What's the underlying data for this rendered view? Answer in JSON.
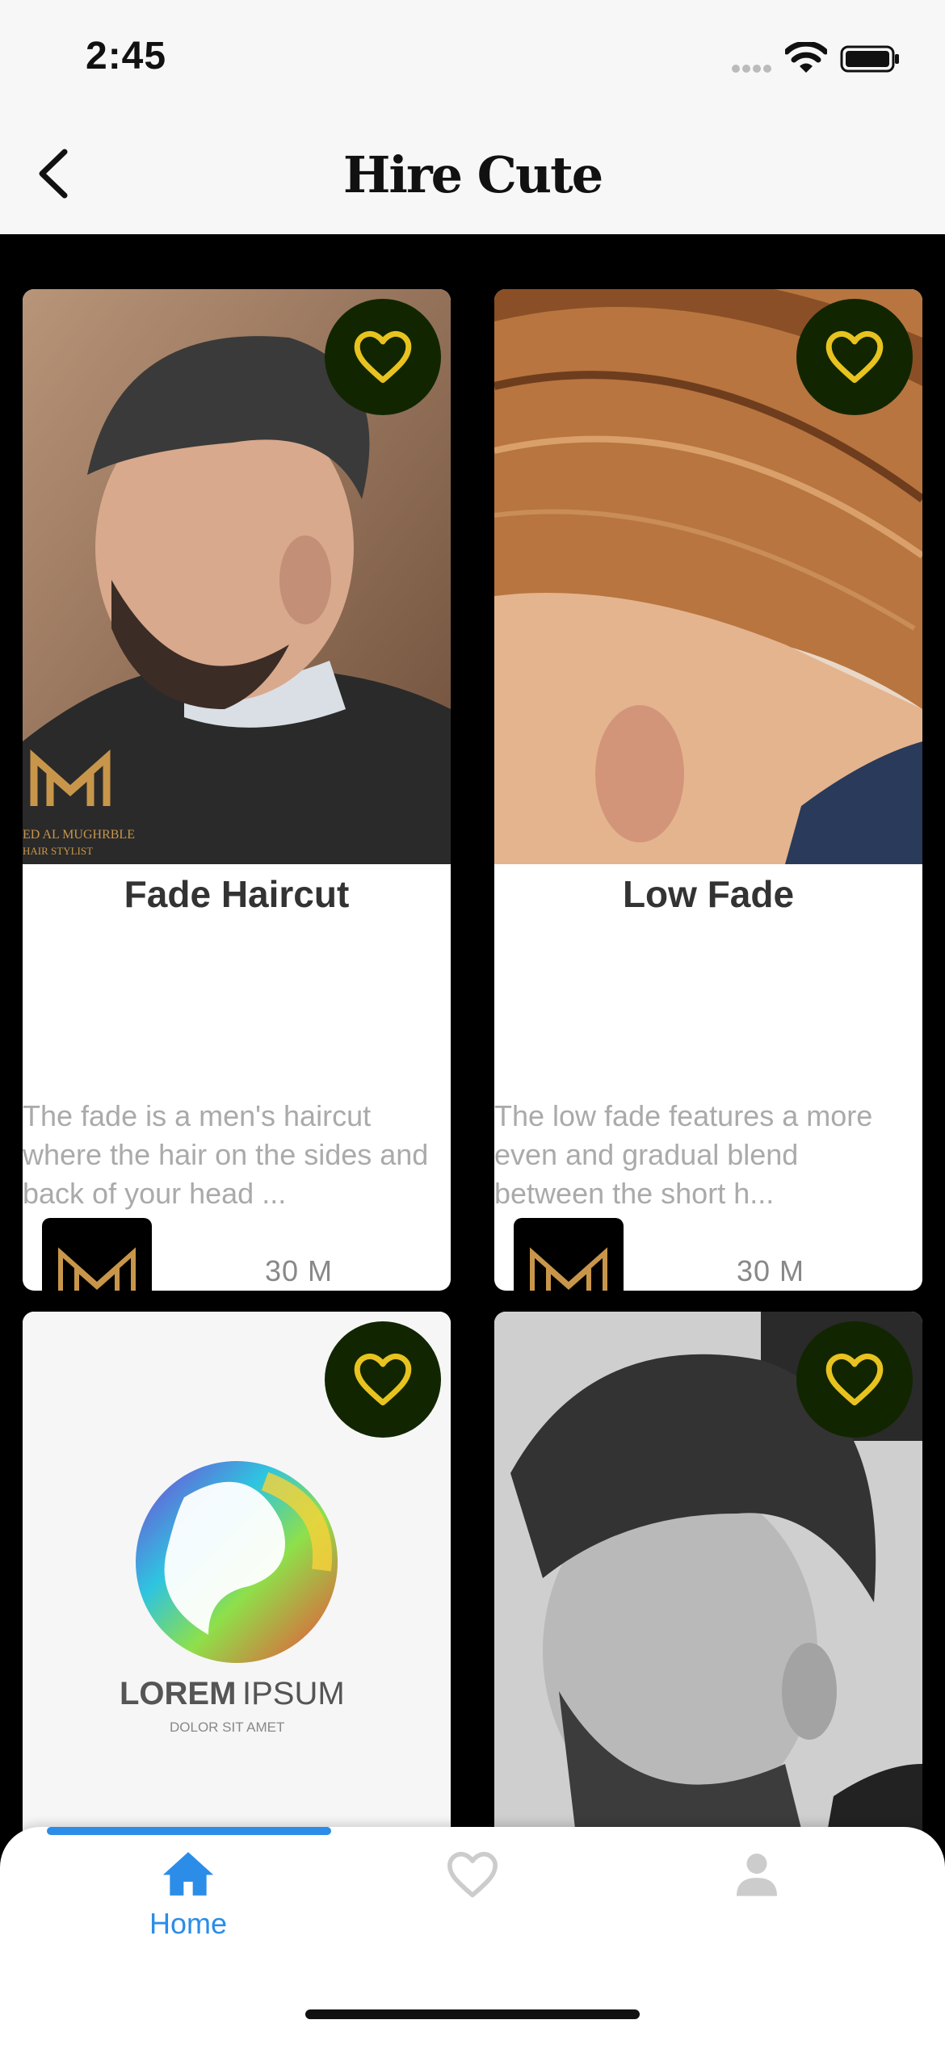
{
  "status_bar": {
    "time": "2:45"
  },
  "nav": {
    "title": "Hire Cute"
  },
  "cards": [
    {
      "title": "Fade Haircut",
      "description": "The fade is a men's haircut where the hair on the sides and back of your head ...",
      "duration": "30 M",
      "watermark_line1": "ED AL MUGHRBLE",
      "watermark_line2": "HAIR STYLIST"
    },
    {
      "title": "Low Fade",
      "description": "The low fade features a more even and gradual blend between the short h...",
      "duration": "30 M"
    },
    {
      "title": "",
      "description": "",
      "duration": "",
      "logo_text_bold": "LOREM",
      "logo_text_light": "IPSUM",
      "logo_subtext": "DOLOR SIT AMET"
    },
    {
      "title": "",
      "description": "",
      "duration": ""
    }
  ],
  "tabs": [
    {
      "label": "Home",
      "icon": "home-icon",
      "active": true
    },
    {
      "label": "",
      "icon": "heart-icon",
      "active": false
    },
    {
      "label": "",
      "icon": "person-icon",
      "active": false
    }
  ],
  "colors": {
    "accent": "#2b8de8",
    "fav_bg": "#112600",
    "fav_heart": "#e8c320",
    "gold": "#c8964a"
  }
}
